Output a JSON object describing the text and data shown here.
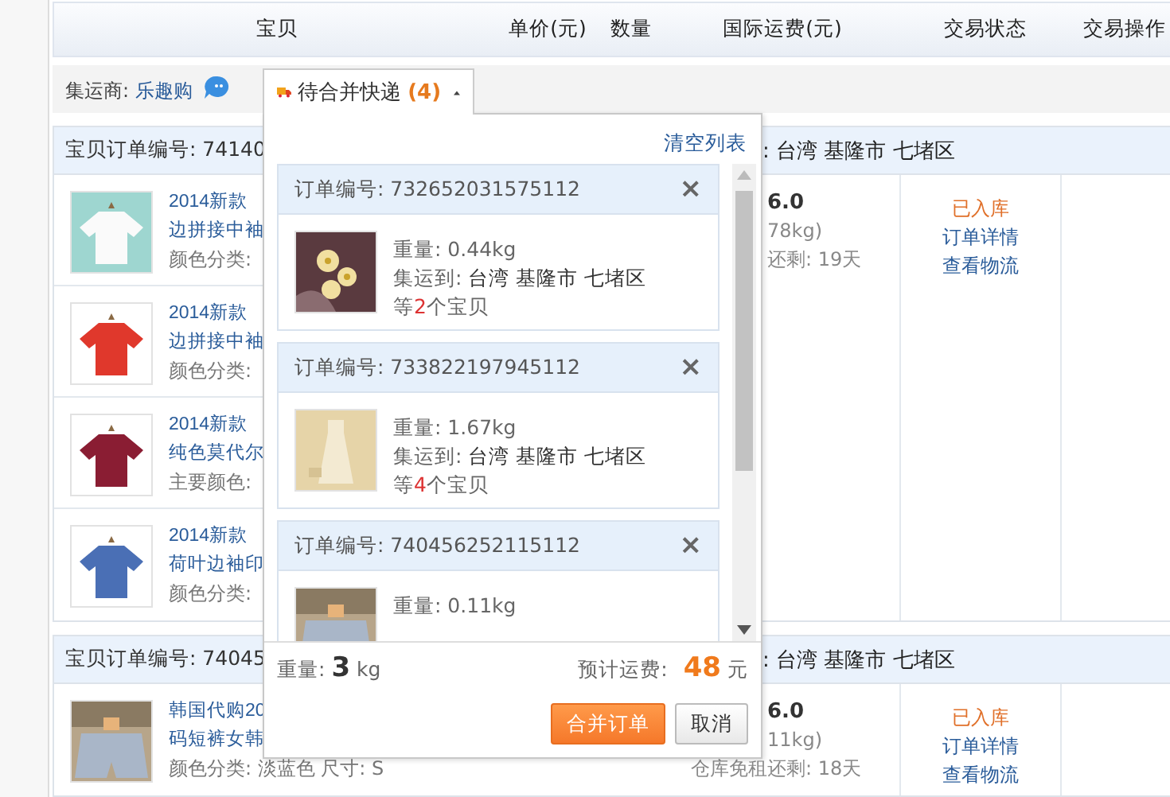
{
  "table_header": {
    "columns": [
      "宝贝",
      "单价(元)",
      "数量",
      "国际运费(元)",
      "交易状态",
      "交易操作"
    ]
  },
  "filter": {
    "label": "集运商:",
    "forwarder": "乐趣购",
    "tab": {
      "label": "待合并快递",
      "count": "(4)",
      "expanded": true
    }
  },
  "orders": [
    {
      "order_no": "宝贝订单编号: 74140",
      "destination": ": 台湾 基隆市 七堵区",
      "items": [
        {
          "title_1": "2014新款",
          "title_2": "边拼接中袖",
          "spec": "颜色分类:"
        },
        {
          "title_1": "2014新款",
          "title_2": "边拼接中袖",
          "spec": "颜色分类:"
        },
        {
          "title_1": "2014新款",
          "title_2": "纯色莫代尔",
          "spec": "主要颜色:"
        },
        {
          "title_1": "2014新款",
          "title_2": "荷叶边袖印",
          "spec": "颜色分类:"
        }
      ],
      "fee": "6.0",
      "weight": "78kg)",
      "storage": "还剩: 19天",
      "status": "已入库",
      "links": [
        "订单详情",
        "查看物流"
      ]
    },
    {
      "order_no": "宝贝订单编号: 74045",
      "destination": ": 台湾 基隆市 七堵区",
      "items": [
        {
          "title_1": "韩国代购20",
          "title_2": "码短裤女韩",
          "spec": "颜色分类: 淡蓝色 尺寸: S"
        }
      ],
      "fee": "6.0",
      "weight": "11kg)",
      "storage": "仓库免租还剩: 18天",
      "status": "已入库",
      "links": [
        "订单详情",
        "查看物流"
      ]
    }
  ],
  "popup": {
    "clear_link": "清空列表",
    "cards": [
      {
        "order_no": "订单编号: 732652031575112",
        "close": "×",
        "weight": "重量: 0.44kg",
        "dest_label": "集运到: ",
        "dest": "台湾 基隆市 七堵区",
        "count_pre": "等",
        "count": "2",
        "count_post": "个宝贝"
      },
      {
        "order_no": "订单编号: 733822197945112",
        "close": "×",
        "weight": "重量: 1.67kg",
        "dest_label": "集运到: ",
        "dest": "台湾 基隆市 七堵区",
        "count_pre": "等",
        "count": "4",
        "count_post": "个宝贝"
      },
      {
        "order_no": "订单编号: 740456252115112",
        "close": "×",
        "weight": "重量: 0.11kg"
      }
    ],
    "total_label": "重量:",
    "total_weight": "3",
    "total_unit": "kg",
    "fee_label": "预计运费:",
    "fee": "48",
    "fee_unit": "元",
    "buttons": [
      {
        "label": "合并订单",
        "kind": "primary"
      },
      {
        "label": "取消",
        "kind": "secondary"
      }
    ]
  }
}
